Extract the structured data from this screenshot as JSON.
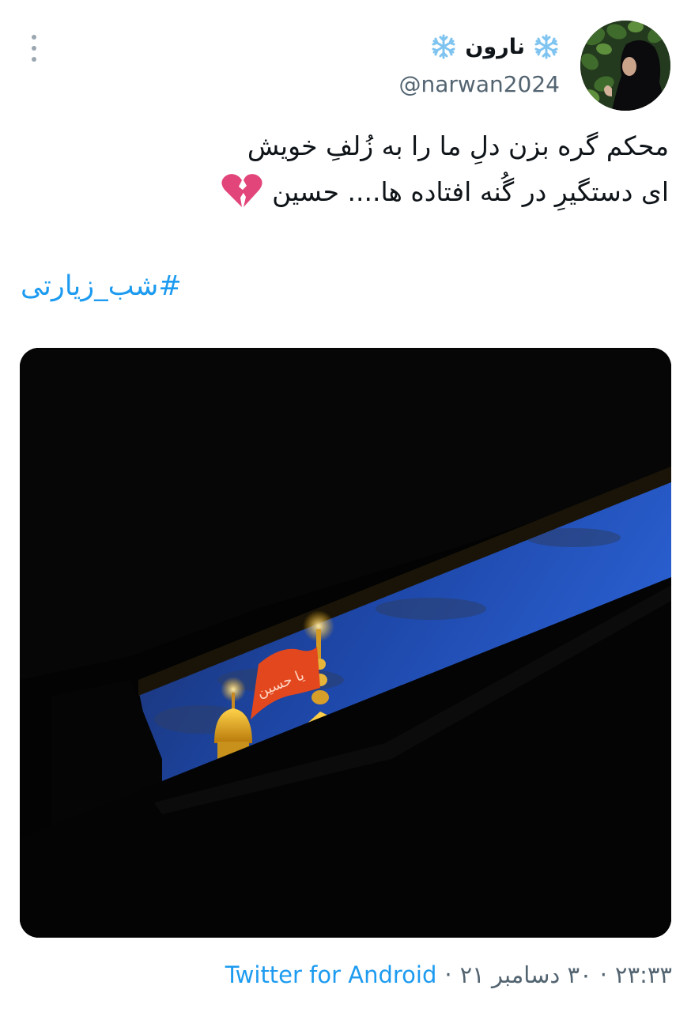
{
  "tweet": {
    "author": {
      "display_name": "نارون",
      "name_decoration": "snowflake-icon",
      "handle": "@narwan2024"
    },
    "text_lines": [
      "محکم گره بزن دلِ ما را به زُلفِ خویش",
      "ای دستگیرِ در گُنه افتاده ها.... حسین"
    ],
    "text_emoji": "broken-heart-icon",
    "hashtag": "#شب_زیارتی",
    "meta": {
      "time": "۲۳:۳۳",
      "date": "۳۰ دسامبر ۲۱",
      "separator": "·",
      "source": "Twitter for Android"
    },
    "media": {
      "flag_text": "یا حسین"
    }
  },
  "colors": {
    "link": "#1d9bf0",
    "secondary_text": "#536471",
    "primary_text": "#0f1419",
    "heart": "#e2457a"
  }
}
